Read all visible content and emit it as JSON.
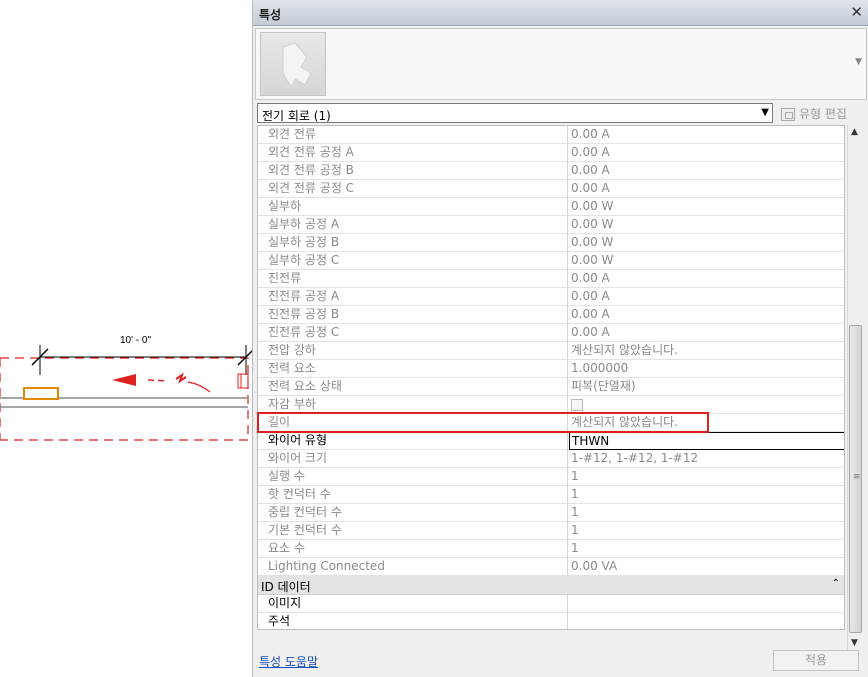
{
  "drawing": {
    "dimension_label": "10' - 0\""
  },
  "palette": {
    "title": "특성",
    "close_glyph": "✕",
    "instance_selector": "전기 회로 (1)",
    "edit_type_label": "유형 편집",
    "help_link": "특성 도움말",
    "apply_label": "적용"
  },
  "properties": [
    {
      "name": "외견 전류",
      "value": "0.00 A",
      "editable": false
    },
    {
      "name": "외견 전류 공정 A",
      "value": "0.00 A",
      "editable": false
    },
    {
      "name": "외견 전류 공정 B",
      "value": "0.00 A",
      "editable": false
    },
    {
      "name": "외견 전류 공정 C",
      "value": "0.00 A",
      "editable": false
    },
    {
      "name": "실부하",
      "value": "0.00 W",
      "editable": false
    },
    {
      "name": "실부하 공정 A",
      "value": "0.00 W",
      "editable": false
    },
    {
      "name": "실부하 공정 B",
      "value": "0.00 W",
      "editable": false
    },
    {
      "name": "실부하 공정 C",
      "value": "0.00 W",
      "editable": false
    },
    {
      "name": "진전류",
      "value": "0.00 A",
      "editable": false
    },
    {
      "name": "진전류 공정 A",
      "value": "0.00 A",
      "editable": false
    },
    {
      "name": "진전류 공정 B",
      "value": "0.00 A",
      "editable": false
    },
    {
      "name": "진전류 공정 C",
      "value": "0.00 A",
      "editable": false
    },
    {
      "name": "전압 강하",
      "value": "계산되지 않았습니다.",
      "editable": false
    },
    {
      "name": "전력 요소",
      "value": "1.000000",
      "editable": false
    },
    {
      "name": "전력 요소 상태",
      "value": "피복(단열재)",
      "editable": false
    },
    {
      "name": "자감 부하",
      "value": "",
      "editable": false,
      "checkbox": true
    },
    {
      "name": "길이",
      "value": "계산되지 않았습니다.",
      "editable": false,
      "highlighted": true
    },
    {
      "name": "와이어 유형",
      "value": "THWN",
      "editable": true,
      "selected": true
    },
    {
      "name": "와이어 크기",
      "value": "1-#12, 1-#12, 1-#12",
      "editable": false
    },
    {
      "name": "실행 수",
      "value": "1",
      "editable": false
    },
    {
      "name": "핫 컨덕터 수",
      "value": "1",
      "editable": false
    },
    {
      "name": "중립 컨덕터 수",
      "value": "1",
      "editable": false
    },
    {
      "name": "기본 컨덕터 수",
      "value": "1",
      "editable": false
    },
    {
      "name": "요소 수",
      "value": "1",
      "editable": false
    },
    {
      "name": "Lighting Connected",
      "value": "0.00 VA",
      "editable": false
    }
  ],
  "groups": [
    {
      "name": "ID 데이터",
      "collapse_glyph": "⌃",
      "properties": [
        {
          "name": "이미지",
          "value": "",
          "editable": true
        },
        {
          "name": "주석",
          "value": "",
          "editable": true
        }
      ]
    }
  ]
}
